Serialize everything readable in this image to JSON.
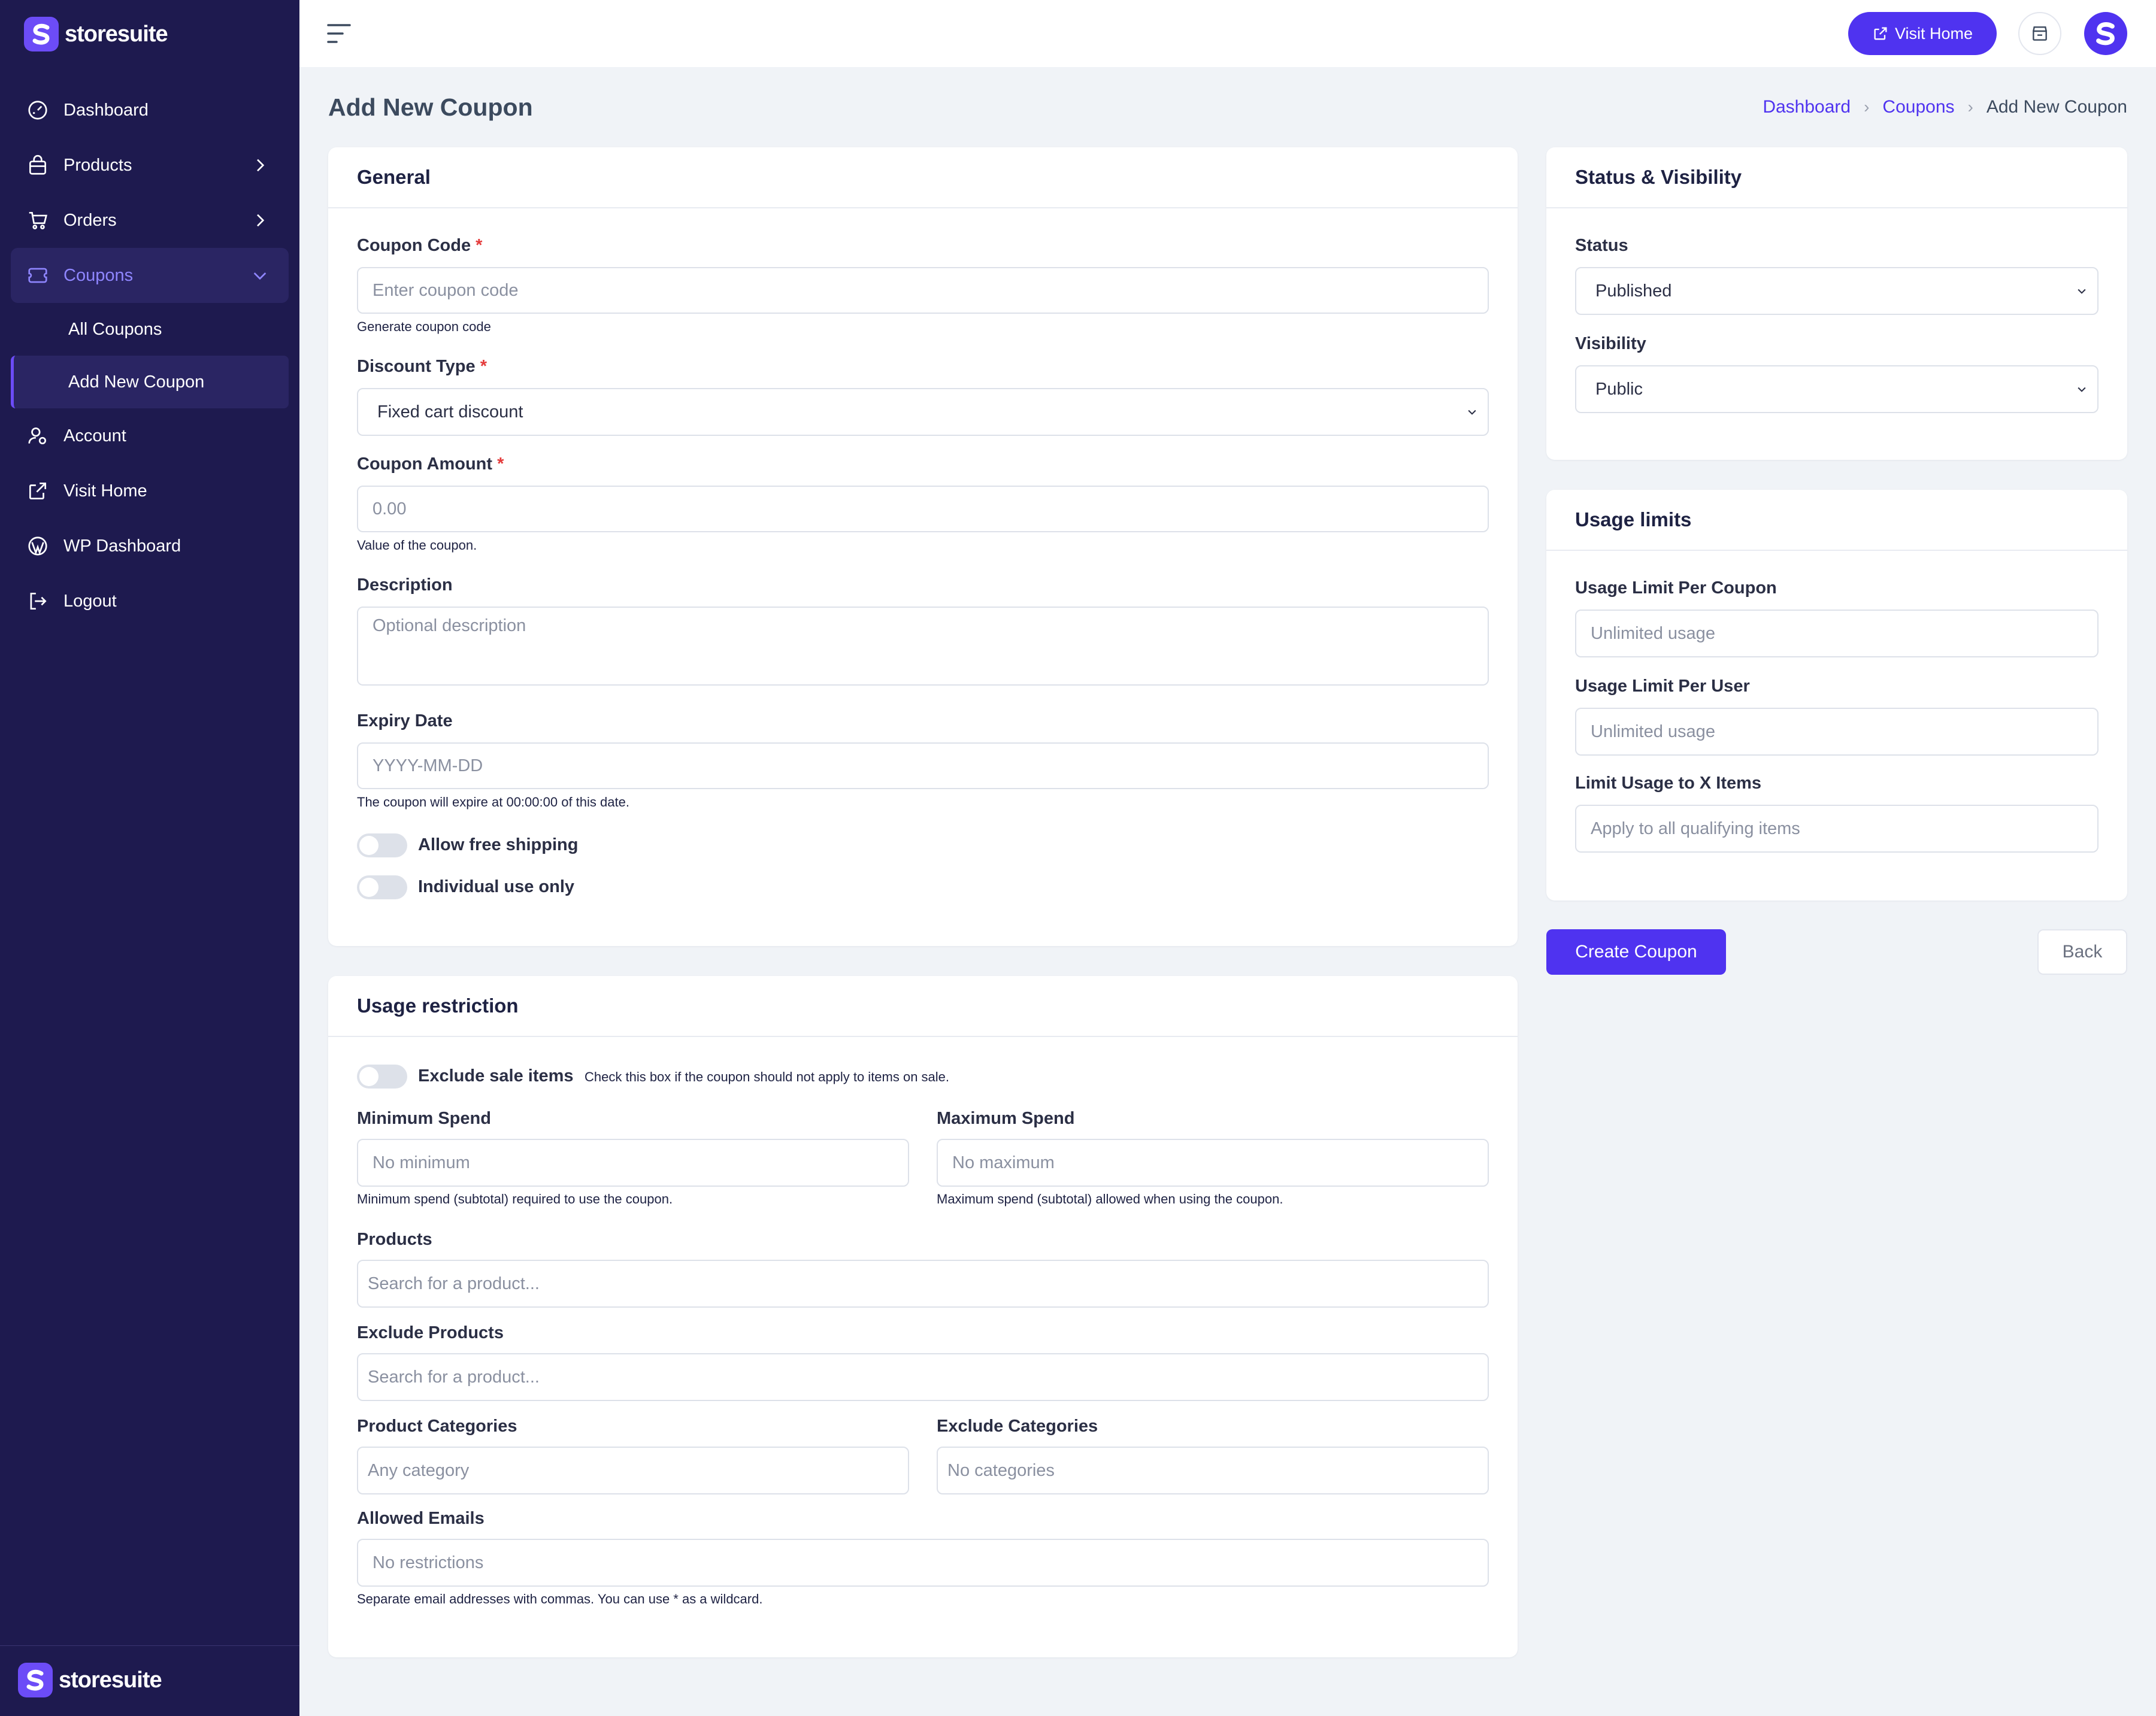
{
  "brand": {
    "name": "storesuite",
    "logo_letter": "S"
  },
  "sidebar": {
    "items": [
      {
        "label": "Dashboard",
        "icon": "gauge-icon"
      },
      {
        "label": "Products",
        "icon": "bag-icon"
      },
      {
        "label": "Orders",
        "icon": "cart-icon"
      },
      {
        "label": "Coupons",
        "icon": "ticket-icon"
      },
      {
        "label": "Account",
        "icon": "user-gear-icon"
      },
      {
        "label": "Visit Home",
        "icon": "external-link-icon"
      },
      {
        "label": "WP Dashboard",
        "icon": "wordpress-icon"
      },
      {
        "label": "Logout",
        "icon": "logout-icon"
      }
    ],
    "coupons_sub": [
      {
        "label": "All Coupons"
      },
      {
        "label": "Add New Coupon"
      }
    ]
  },
  "topbar": {
    "visit_home": "Visit Home"
  },
  "page": {
    "title": "Add New Coupon"
  },
  "breadcrumb": {
    "items": [
      "Dashboard",
      "Coupons",
      "Add New Coupon"
    ]
  },
  "general": {
    "title": "General",
    "coupon_code": {
      "label": "Coupon Code",
      "placeholder": "Enter coupon code",
      "hint": "Generate coupon code"
    },
    "discount_type": {
      "label": "Discount Type",
      "value": "Fixed cart discount"
    },
    "coupon_amount": {
      "label": "Coupon Amount",
      "value": "0.00",
      "hint": "Value of the coupon."
    },
    "description": {
      "label": "Description",
      "placeholder": "Optional description"
    },
    "expiry_date": {
      "label": "Expiry Date",
      "placeholder": "YYYY-MM-DD",
      "hint": "The coupon will expire at 00:00:00 of this date."
    },
    "free_shipping": "Allow free shipping",
    "individual_use": "Individual use only"
  },
  "restriction": {
    "title": "Usage restriction",
    "exclude_sale": {
      "label": "Exclude sale items",
      "hint": "Check this box if the coupon should not apply to items on sale."
    },
    "min_spend": {
      "label": "Minimum Spend",
      "placeholder": "No minimum",
      "hint": "Minimum spend (subtotal) required to use the coupon."
    },
    "max_spend": {
      "label": "Maximum Spend",
      "placeholder": "No maximum",
      "hint": "Maximum spend (subtotal) allowed when using the coupon."
    },
    "products": {
      "label": "Products",
      "placeholder": "Search for a product..."
    },
    "exclude_products": {
      "label": "Exclude Products",
      "placeholder": "Search for a product..."
    },
    "product_categories": {
      "label": "Product Categories",
      "placeholder": "Any category"
    },
    "exclude_categories": {
      "label": "Exclude Categories",
      "placeholder": "No categories"
    },
    "allowed_emails": {
      "label": "Allowed Emails",
      "placeholder": "No restrictions",
      "hint": "Separate email addresses with commas. You can use * as a wildcard."
    }
  },
  "status_card": {
    "title": "Status & Visibility",
    "status": {
      "label": "Status",
      "value": "Published"
    },
    "visibility": {
      "label": "Visibility",
      "value": "Public"
    }
  },
  "usage_limits": {
    "title": "Usage limits",
    "per_coupon": {
      "label": "Usage Limit Per Coupon",
      "placeholder": "Unlimited usage"
    },
    "per_user": {
      "label": "Usage Limit Per User",
      "placeholder": "Unlimited usage"
    },
    "x_items": {
      "label": "Limit Usage to X Items",
      "placeholder": "Apply to all qualifying items"
    }
  },
  "actions": {
    "create": "Create Coupon",
    "back": "Back"
  },
  "colors": {
    "sidebar_bg": "#1e1a4f",
    "accent": "#4f33f0",
    "page_bg": "#f0f3f7"
  }
}
